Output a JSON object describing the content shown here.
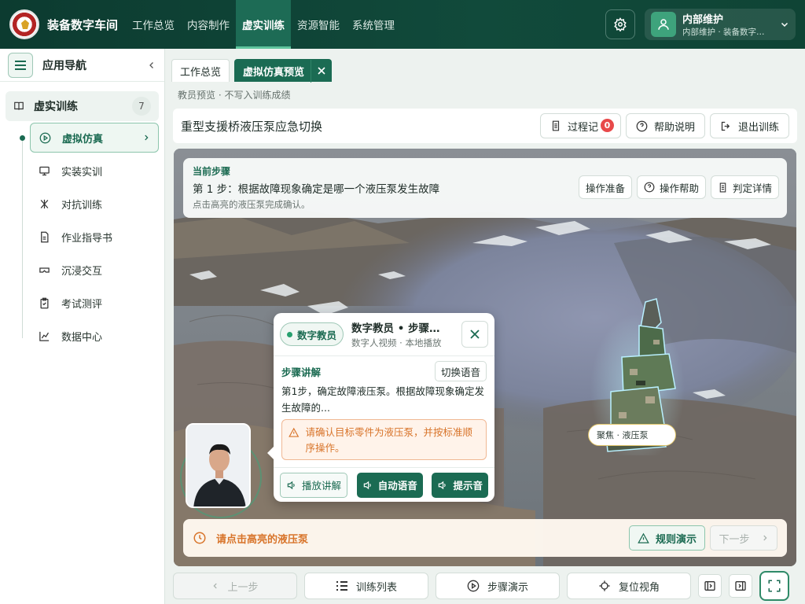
{
  "app": {
    "title": "装备数字车间"
  },
  "nav": [
    {
      "label": "工作总览",
      "active": false
    },
    {
      "label": "内容制作",
      "active": false
    },
    {
      "label": "虚实训练",
      "active": true
    },
    {
      "label": "资源智能",
      "active": false
    },
    {
      "label": "系统管理",
      "active": false
    }
  ],
  "user": {
    "name": "内部维护",
    "sub": "内部维护 · 装备数字车间"
  },
  "sidebar": {
    "title": "应用导航",
    "group": {
      "label": "虚实训练",
      "count": "7"
    },
    "items": [
      {
        "label": "虚拟仿真",
        "icon": "play-circle-icon",
        "active": true
      },
      {
        "label": "实装实训",
        "icon": "monitor-icon",
        "active": false
      },
      {
        "label": "对抗训练",
        "icon": "swords-icon",
        "active": false
      },
      {
        "label": "作业指导书",
        "icon": "document-icon",
        "active": false
      },
      {
        "label": "沉浸交互",
        "icon": "vr-goggles-icon",
        "active": false
      },
      {
        "label": "考试测评",
        "icon": "clipboard-icon",
        "active": false
      },
      {
        "label": "数据中心",
        "icon": "chart-icon",
        "active": false
      }
    ]
  },
  "tabs": [
    {
      "label": "工作总览",
      "active": false
    },
    {
      "label": "虚拟仿真预览",
      "active": true
    }
  ],
  "preview_note": "教员预览 · 不写入训练成绩",
  "scene": {
    "title": "重型支援桥液压泵应急切换",
    "actions": {
      "process": "过程记",
      "process_badge": "0",
      "help": "帮助说明",
      "exit": "退出训练"
    }
  },
  "step": {
    "heading": "当前步骤",
    "text": "第 1 步：根据故障现象确定是哪一个液压泵发生故障",
    "hint": "点击高亮的液压泵完成确认。",
    "actions": {
      "prep": "操作准备",
      "help": "操作帮助",
      "detail": "判定详情"
    }
  },
  "focus_label": "聚焦 · 液压泵",
  "guide": {
    "pill": "数字教员",
    "title": "数字教员 • 步骤讲解",
    "subtitle": "数字人视频 · 本地播放",
    "explain_title": "步骤讲解",
    "switch_voice": "切换语音",
    "explain_text": "第1步，确定故障液压泵。根据故障现象确定发生故障的...",
    "warning": "请确认目标零件为液压泵，并按标准顺序操作。",
    "buttons": {
      "play": "播放讲解",
      "auto": "自动语音",
      "prompt": "提示音"
    }
  },
  "bottom": {
    "hint": "请点击高亮的液压泵",
    "rule_demo": "规则演示",
    "next": "下一步"
  },
  "toolbar": {
    "prev": "上一步",
    "list": "训练列表",
    "demo": "步骤演示",
    "reset_view": "复位视角"
  },
  "colors": {
    "primary": "#1b6b53",
    "header": "#0c3b30",
    "warning": "#d8742a",
    "badge": "#e8494a"
  }
}
